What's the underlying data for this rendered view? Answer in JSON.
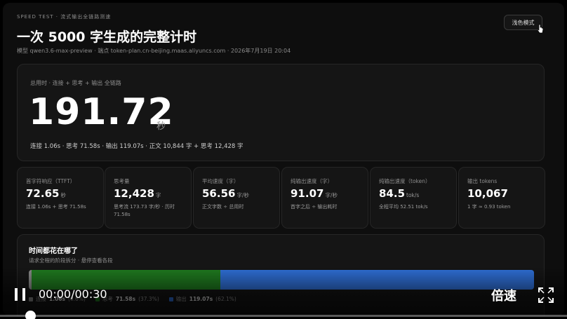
{
  "header": {
    "kicker": "SPEED TEST · 流式输出全链路测速",
    "title": "一次 5000 字生成的完整计时",
    "meta": "模型 qwen3.6-max-preview · 端点 token-plan.cn-beijing.maas.aliyuncs.com · 2026年7月19日 20:04",
    "theme_button": "浅色模式"
  },
  "hero": {
    "label": "总用时 · 连接 + 思考 + 输出 全链路",
    "value": "191.72",
    "unit": "秒",
    "sub": "连接 1.06s · 思考 71.58s · 输出 119.07s · 正文 10,844 字 + 思考 12,428 字"
  },
  "cards": [
    {
      "label": "首字符响应（TTFT）",
      "value": "72.65",
      "unit": "秒",
      "note": "连接 1.06s + 思考 71.58s"
    },
    {
      "label": "思考量",
      "value": "12,428",
      "unit": "字",
      "note": "思考流 173.73 字/秒 · 历时 71.58s"
    },
    {
      "label": "平均速度（字）",
      "value": "56.56",
      "unit": "字/秒",
      "note": "正文字数 ÷ 总用时"
    },
    {
      "label": "纯输出速度（字）",
      "value": "91.07",
      "unit": "字/秒",
      "note": "首字之后 ÷ 输出耗时"
    },
    {
      "label": "纯输出速度（token）",
      "value": "84.5",
      "unit": "tok/s",
      "note": "全程平均 52.51 tok/s"
    },
    {
      "label": "输出 tokens",
      "value": "10,067",
      "unit": "",
      "note": "1 字 ≈ 0.93 token"
    }
  ],
  "timeline": {
    "title": "时间都花在哪了",
    "subtitle": "请求全程的阶段拆分 · 悬停查看各段",
    "segments": [
      {
        "name": "连接",
        "seconds": 1.06,
        "fraction": 0.006,
        "color": "#8a8a8a"
      },
      {
        "name": "思考",
        "seconds": 71.58,
        "fraction": 0.373,
        "color": "#1f7a1f"
      },
      {
        "name": "输出",
        "seconds": 119.07,
        "fraction": 0.621,
        "color": "#2f6fd6"
      }
    ],
    "legend": [
      {
        "name": "连接",
        "value": "1.06s",
        "pct": "(0.6%)",
        "color": "#8a8a8a"
      },
      {
        "name": "思考",
        "value": "71.58s",
        "pct": "(37.3%)",
        "color": "#1f7a1f"
      },
      {
        "name": "输出",
        "value": "119.07s",
        "pct": "(62.1%)",
        "color": "#2f6fd6"
      }
    ]
  },
  "player": {
    "time": "00:00/00:30",
    "speed_label": "倍速",
    "progress": 0.0
  }
}
